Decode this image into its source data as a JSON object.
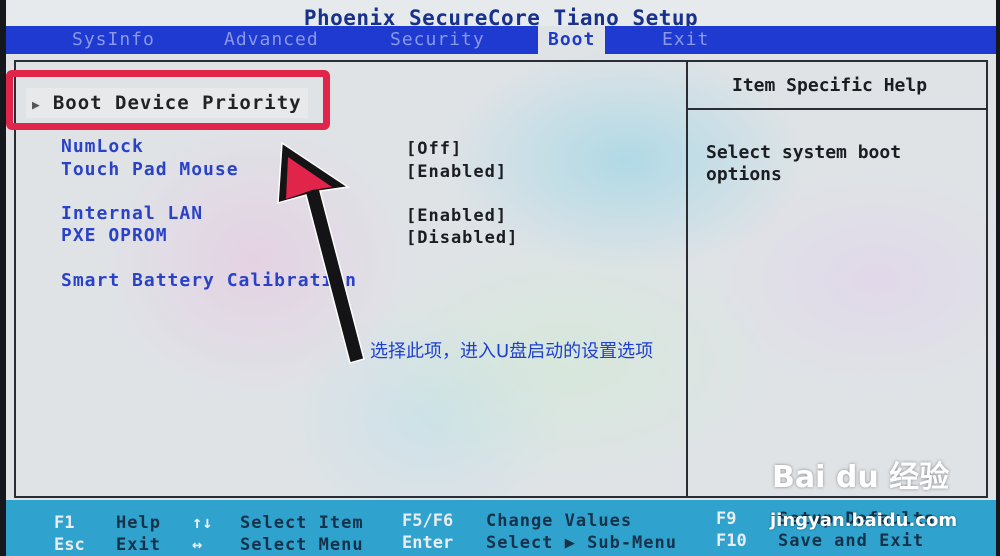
{
  "window": {
    "title": "Phoenix SecureCore Tiano Setup"
  },
  "menu": {
    "tabs": [
      {
        "label": "SysInfo"
      },
      {
        "label": "Advanced"
      },
      {
        "label": "Security"
      },
      {
        "label": "Boot",
        "active": true
      },
      {
        "label": "Exit"
      }
    ]
  },
  "main": {
    "selected": {
      "marker": "▶",
      "label": "Boot Device Priority"
    },
    "settings": [
      {
        "label": "NumLock",
        "value": "[Off]"
      },
      {
        "label": "Touch Pad Mouse",
        "value": "[Enabled]"
      },
      {
        "label": "Internal LAN",
        "value": "[Enabled]"
      },
      {
        "label": "PXE OPROM",
        "value": "[Disabled]"
      },
      {
        "label": "Smart Battery Calibration",
        "value": ""
      }
    ]
  },
  "help": {
    "title": "Item Specific Help",
    "text": "Select system boot options"
  },
  "annotation": {
    "text": "选择此项，进入U盘启动的设置选项"
  },
  "footer": {
    "row1": [
      {
        "key": "F1",
        "label": "Help"
      },
      {
        "key": "↑↓",
        "label": "Select Item"
      },
      {
        "key": "F5/F6",
        "label": "Change Values"
      },
      {
        "key": "F9",
        "label": "Setup Defaults"
      }
    ],
    "row2": [
      {
        "key": "Esc",
        "label": "Exit"
      },
      {
        "key": "↔",
        "label": "Select Menu"
      },
      {
        "key": "Enter",
        "label": "Select ▶ Sub-Menu"
      },
      {
        "key": "F10",
        "label": "Save and Exit"
      }
    ]
  },
  "watermark": {
    "brand": "Bai du 经验",
    "url": "jingyan.baidu.com"
  },
  "colors": {
    "menubar": "#1e3ad0",
    "highlight": "#e0244a",
    "item_text": "#2a42c8",
    "footer": "#2fa2ce"
  }
}
